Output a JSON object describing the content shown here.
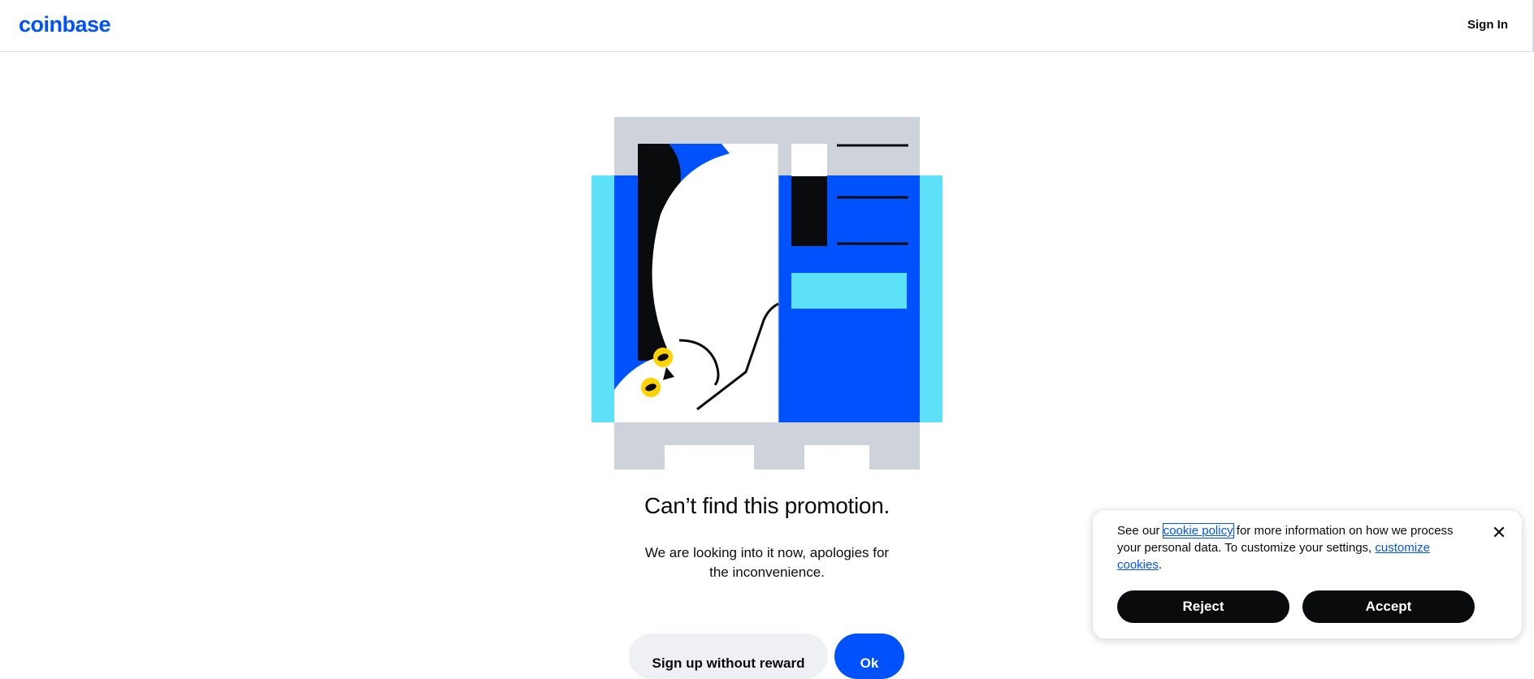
{
  "header": {
    "logo": "coinbase",
    "sign_in": "Sign In"
  },
  "main": {
    "title": "Can’t find this promotion.",
    "subtitle": "We are looking into it now, apologies for the inconvenience.",
    "secondary_button": "Sign up without reward",
    "primary_button": "Ok"
  },
  "cookie_banner": {
    "text_before": "See our ",
    "policy_link": "cookie policy",
    "text_middle": " for more information on how we process your personal data. To customize your settings, ",
    "customize_link": "customize cookies",
    "text_after": ".",
    "reject": "Reject",
    "accept": "Accept",
    "close_icon": "close-icon"
  },
  "colors": {
    "brand_blue": "#0052ff",
    "cyan": "#5ce1f8",
    "gray": "#ced2db",
    "black": "#0a0b0d",
    "yellow": "#ffd200"
  }
}
